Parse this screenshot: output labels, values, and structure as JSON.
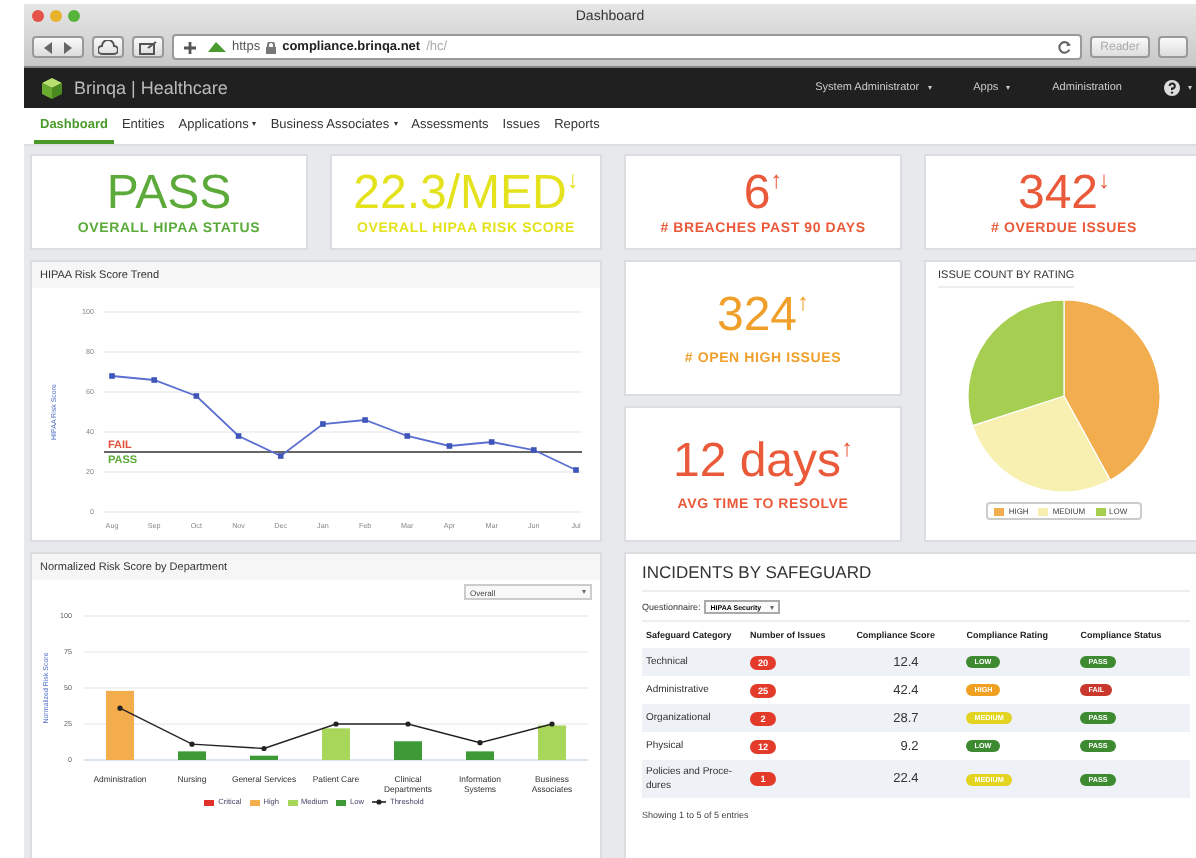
{
  "browser": {
    "title": "Dashboard",
    "scheme": "https",
    "host": "compliance.brinqa.net",
    "path": "/hc/",
    "reader": "Reader"
  },
  "app": {
    "brand": "Brinqa | Healthcare",
    "menu": [
      {
        "label": "System Administrator",
        "dropdown": true
      },
      {
        "label": "Apps",
        "dropdown": true
      },
      {
        "label": "Administration",
        "dropdown": false
      }
    ]
  },
  "tabs": [
    {
      "label": "Dashboard",
      "selected": true,
      "dropdown": false
    },
    {
      "label": "Entities",
      "selected": false,
      "dropdown": false
    },
    {
      "label": "Applications",
      "selected": false,
      "dropdown": true
    },
    {
      "label": "Business Associates",
      "selected": false,
      "dropdown": true
    },
    {
      "label": "Assessments",
      "selected": false,
      "dropdown": false
    },
    {
      "label": "Issues",
      "selected": false,
      "dropdown": false
    },
    {
      "label": "Reports",
      "selected": false,
      "dropdown": false
    }
  ],
  "top_stats": [
    {
      "value": "PASS",
      "label": "OVERALL HIPAA STATUS",
      "color": "#5cab3a"
    },
    {
      "value": "22.3/MED$^{↓}$",
      "label": "OVERALL HIPAA RISK SCORE",
      "color": "#e4e21c"
    },
    {
      "value": "6$^{↑}$",
      "label": "# BREACHES PAST 90 DAYS",
      "color": "#ea5a3a"
    },
    {
      "value": "342$^{↓}$",
      "label": "# OVERDUE ISSUES",
      "color": "#ea5a3a"
    }
  ],
  "side_stats": [
    {
      "value": "324$^{↑}$",
      "label": "# OPEN HIGH ISSUES",
      "color": "#f0a02a"
    },
    {
      "value": "12 days$^{↑}$",
      "label": "AVG TIME TO RESOLVE",
      "color": "#ea5a3a"
    }
  ],
  "trend": {
    "title": "HIPAA Risk Score Trend",
    "chart_data": {
      "type": "line",
      "ylabel": "HIPAA Risk Score",
      "categories": [
        "Aug",
        "Sep",
        "Oct",
        "Nov",
        "Dec",
        "Jan",
        "Feb",
        "Mar",
        "Apr",
        "Mar",
        "Jun",
        "Jul"
      ],
      "series": [
        {
          "color": "#5a6fd0",
          "marker": "square",
          "values": [
            68,
            66,
            58,
            38,
            28,
            44,
            46,
            38,
            33,
            35,
            31,
            21
          ]
        }
      ],
      "ylim": [
        0,
        100
      ],
      "yticks": [
        0,
        20,
        40,
        60,
        80,
        100
      ],
      "grid": true,
      "ref_lines": [
        {
          "axis": "y",
          "value": 30,
          "color": "#333333"
        }
      ]
    },
    "zone_labels": [
      {
        "text": "FAIL",
        "color": "#e0503a"
      },
      {
        "text": "PASS",
        "color": "#5cab3a"
      }
    ]
  },
  "rating_pie": {
    "title": "ISSUE COUNT BY RATING",
    "legend": [
      {
        "label": "HIGH",
        "color": "#f2ad4e"
      },
      {
        "label": "MEDIUM",
        "color": "#f8f0b0"
      },
      {
        "label": "LOW",
        "color": "#a6cf52"
      }
    ]
  },
  "department": {
    "title": "Normalized Risk Score by Department",
    "filter": "Overall",
    "chart_data": {
      "type": "bar",
      "ylabel": "Normalized Risk Score",
      "categories": [
        "Administration",
        "Nursing",
        "General Services",
        "Patient Care",
        "Clinical Departments",
        "Information Systems",
        "Business Associates"
      ],
      "series": [
        {
          "name": "Critical",
          "color": "#e0302a",
          "values": [
            null,
            null,
            null,
            null,
            null,
            null,
            null
          ]
        },
        {
          "name": "High",
          "color": "#f3ad4c",
          "values": [
            48,
            null,
            null,
            null,
            null,
            null,
            null
          ]
        },
        {
          "name": "Medium",
          "color": "#a8d65a",
          "values": [
            null,
            null,
            null,
            22,
            null,
            null,
            24
          ]
        },
        {
          "name": "Low",
          "color": "#3e9a36",
          "values": [
            null,
            6,
            3,
            null,
            13,
            6,
            null
          ]
        },
        {
          "name": "Threshold",
          "color": "#222222",
          "type": "line",
          "values": [
            36,
            11,
            8,
            25,
            25,
            12,
            25
          ]
        }
      ],
      "ylim": [
        0,
        100
      ],
      "yticks": [
        0,
        25,
        50,
        75,
        100
      ],
      "grid": true,
      "legend": true
    }
  },
  "incidents": {
    "title": "INCIDENTS BY SAFEGUARD",
    "questionnaire_label": "Questionnaire:",
    "questionnaire": "HIPAA Security",
    "columns": [
      "Safeguard Category",
      "Number of Issues",
      "Compliance Score",
      "Compliance Rating",
      "Compliance Status"
    ],
    "rows": [
      {
        "category": "Technical",
        "issues": "20",
        "score": "12.4",
        "rating": {
          "text": "LOW",
          "color": "#3e8a30"
        },
        "status": {
          "text": "PASS",
          "color": "#3e8a30"
        }
      },
      {
        "category": "Administrative",
        "issues": "25",
        "score": "42.4",
        "rating": {
          "text": "HIGH",
          "color": "#f0a020"
        },
        "status": {
          "text": "FAIL",
          "color": "#c8382c"
        }
      },
      {
        "category": "Organizational",
        "issues": "2",
        "score": "28.7",
        "rating": {
          "text": "MEDIUM",
          "color": "#e2d420"
        },
        "status": {
          "text": "PASS",
          "color": "#3e8a30"
        }
      },
      {
        "category": "Physical",
        "issues": "12",
        "score": "9.2",
        "rating": {
          "text": "LOW",
          "color": "#3e8a30"
        },
        "status": {
          "text": "PASS",
          "color": "#3e8a30"
        }
      },
      {
        "category": "Policies and Proce-dures",
        "issues": "1",
        "score": "22.4",
        "rating": {
          "text": "MEDIUM",
          "color": "#e2d420"
        },
        "status": {
          "text": "PASS",
          "color": "#3e8a30"
        }
      }
    ],
    "footer": "Showing 1 to 5 of 5 entries"
  }
}
